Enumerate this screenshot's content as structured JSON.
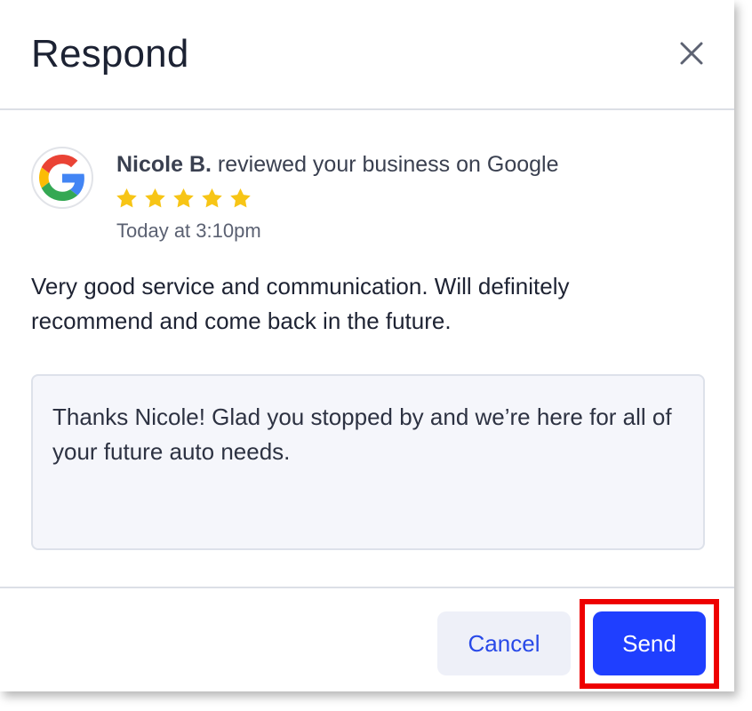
{
  "dialog": {
    "title": "Respond",
    "close_icon": "close-icon"
  },
  "review": {
    "source_icon": "google-g-logo-icon",
    "reviewer_name": "Nicole B.",
    "action_text": " reviewed your business on Google",
    "rating": 5,
    "rating_max": 5,
    "star_icon": "star-icon",
    "star_color": "#f7c516",
    "timestamp": "Today at 3:10pm",
    "body": "Very good service and communication. Will definitely recommend and come back in the future."
  },
  "reply": {
    "value": "Thanks Nicole! Glad you stopped by and we’re here for all of your future auto needs.",
    "placeholder": ""
  },
  "footer": {
    "cancel_label": "Cancel",
    "send_label": "Send"
  },
  "colors": {
    "primary": "#1f3fff",
    "highlight": "#ee0000",
    "cancel_bg": "#eef0f8"
  }
}
